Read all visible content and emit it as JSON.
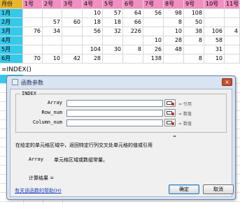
{
  "sheet": {
    "header": [
      "月份",
      "1号",
      "2号",
      "3号",
      "4号",
      "5号",
      "6号",
      "7号",
      "8号",
      "9号",
      "10号",
      "11号"
    ],
    "rows": [
      {
        "month": "1月",
        "values": [
          "",
          "",
          "",
          "10",
          "57",
          "64",
          "56",
          "98",
          "108",
          "",
          ""
        ]
      },
      {
        "month": "2月",
        "values": [
          "",
          "57",
          "60",
          "18",
          "18",
          "66",
          "",
          "8",
          "50",
          "",
          ""
        ]
      },
      {
        "month": "3月",
        "values": [
          "76",
          "34",
          "",
          "56",
          "32",
          "226",
          "",
          "10",
          "38",
          "106",
          "4"
        ]
      },
      {
        "month": "4月",
        "values": [
          "",
          "",
          "",
          "",
          "",
          "",
          "10",
          "28",
          "8",
          "58",
          ""
        ]
      },
      {
        "month": "5月",
        "values": [
          "",
          "",
          "",
          "104",
          "30",
          "8",
          "26",
          "48",
          "",
          "31",
          ""
        ]
      },
      {
        "month": "6月",
        "values": [
          "70",
          "10",
          "42",
          "28",
          "",
          "",
          "138",
          "",
          "8",
          "10",
          ""
        ]
      }
    ],
    "formula_text": "=INDEX()"
  },
  "dialog": {
    "title": "函数参数",
    "close_label": "×",
    "function_name": "INDEX",
    "args": [
      {
        "label": "Array",
        "eq": "= 引用"
      },
      {
        "label": "Row_num",
        "eq": "= 数值"
      },
      {
        "label": "Column_num",
        "eq": "= 数值"
      }
    ],
    "result_eq": "=",
    "description": "在给定的单元格区域中，返回特定行列交叉处单元格的值或引用",
    "param_name": "Array",
    "param_description": "单元格区域或数组常量。",
    "calc_result": "计算结果 =",
    "help_link": "有关该函数的帮助(H)",
    "ok_label": "确定",
    "cancel_label": "取消"
  },
  "colors": {
    "header_pink": "#f08fc0",
    "header_corner": "#e8b62e",
    "month_cyan": "#35c9ea",
    "dialog_frame": "#d9e4f2"
  }
}
